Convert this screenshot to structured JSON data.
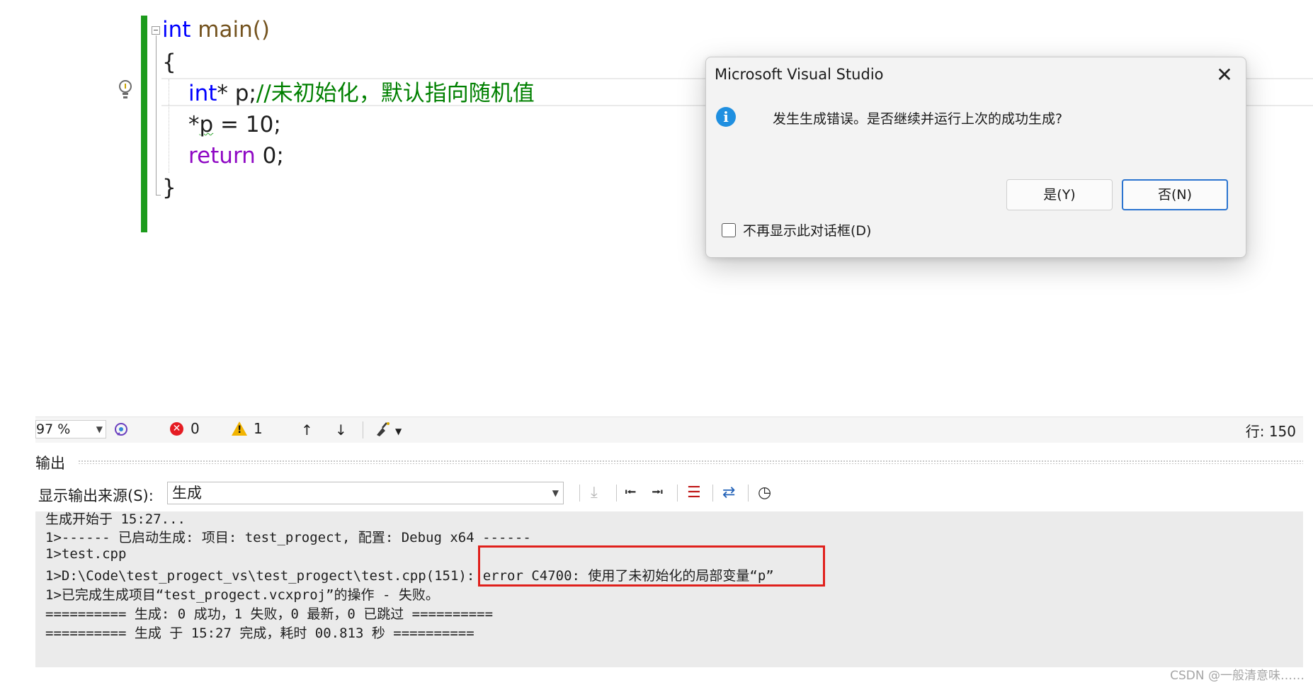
{
  "editor": {
    "lines": [
      {
        "kw": "int",
        "fn": " main()"
      },
      {
        "plain": "{"
      },
      {
        "kw": "int",
        "plain": "* ",
        "var": "p",
        "semi": ";",
        "comment": "//未初始化，默认指向随机值"
      },
      {
        "plain": "*",
        "var": "p",
        "rest": " = 10;"
      },
      {
        "kw": "return",
        "rest": " 0;"
      },
      {
        "plain": "}"
      }
    ],
    "lightbulb_icon": "lightbulb-icon"
  },
  "dialog": {
    "title": "Microsoft Visual Studio",
    "close_glyph": "✕",
    "info_glyph": "i",
    "message": "发生生成错误。是否继续并运行上次的成功生成?",
    "yes_label": "是(Y)",
    "no_label": "否(N)",
    "dont_show_label": "不再显示此对话框(D)"
  },
  "status_bar": {
    "zoom": "97 %",
    "error_count": "0",
    "warning_count": "1",
    "row_label": "行: 150"
  },
  "output": {
    "title": "输出",
    "source_label": "显示输出来源(S):",
    "source_value": "生成",
    "lines": [
      "生成开始于 15:27...",
      "1>------ 已启动生成: 项目: test_progect, 配置: Debug x64 ------",
      "1>test.cpp",
      "1>D:\\Code\\test_progect_vs\\test_progect\\test.cpp(151): error C4700: 使用了未初始化的局部变量“p”",
      "1>已完成生成项目“test_progect.vcxproj”的操作 - 失败。",
      "========== 生成: 0 成功，1 失败，0 最新，0 已跳过 ==========",
      "========== 生成 于 15:27 完成，耗时 00.813 秒 =========="
    ]
  },
  "watermark": "CSDN @一般清意味……"
}
